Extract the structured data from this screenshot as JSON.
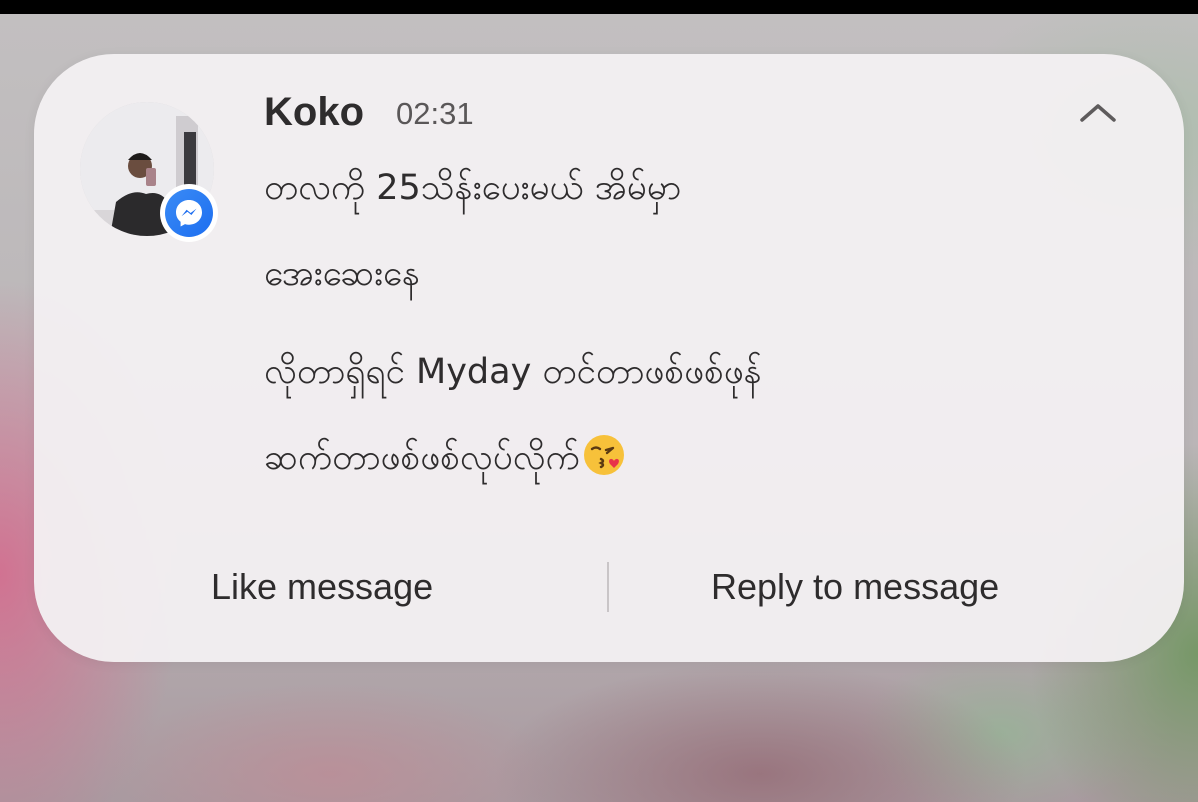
{
  "notification": {
    "app_icon": "messenger-icon",
    "sender": "Koko",
    "time": "02:31",
    "collapse_icon": "chevron-up-icon",
    "message_lines": [
      "တလကို 25သိန်းပေးမယ် အိမ်မှာ",
      "အေးဆေးနေ",
      "လိုတာရှိရင် Myday တင်တာဖစ်ဖစ်ဖုန်",
      "ဆက်တာဖစ်ဖစ်လုပ်လိုက်"
    ],
    "message_emoji": "face-blowing-kiss",
    "actions": {
      "like": "Like message",
      "reply": "Reply to message"
    }
  },
  "colors": {
    "card": "#f3f0f2",
    "text": "#2e2c2d",
    "messenger_blue": "#1d6ef0"
  }
}
